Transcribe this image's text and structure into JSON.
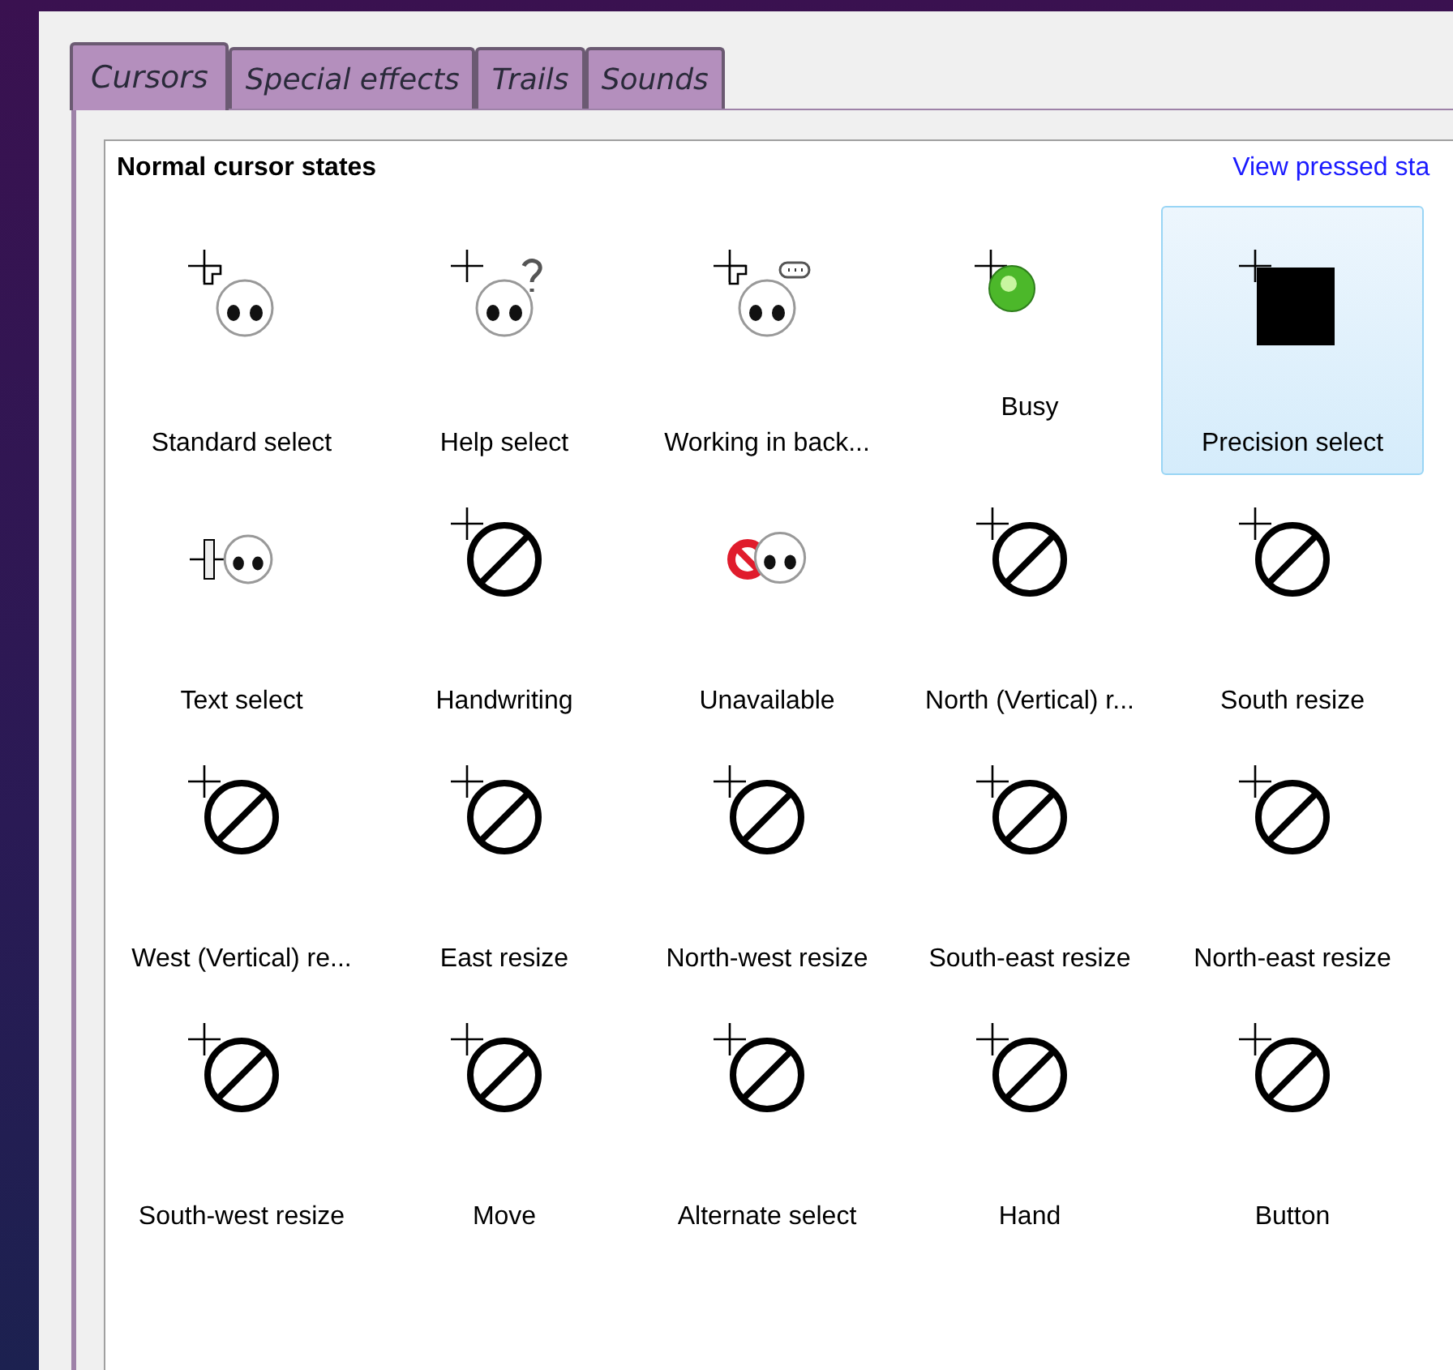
{
  "tabs": [
    {
      "label": "Cursors",
      "selected": true
    },
    {
      "label": "Special effects",
      "selected": false
    },
    {
      "label": "Trails",
      "selected": false
    },
    {
      "label": "Sounds",
      "selected": false
    }
  ],
  "section": {
    "title": "Normal cursor states",
    "link": "View pressed sta"
  },
  "cursors": [
    {
      "label": "Standard select",
      "selected": false
    },
    {
      "label": "Help select",
      "selected": false
    },
    {
      "label": "Working in back...",
      "selected": false
    },
    {
      "label": "Busy",
      "selected": false
    },
    {
      "label": "Precision select",
      "selected": true
    },
    {
      "label": "Text select",
      "selected": false
    },
    {
      "label": "Handwriting",
      "selected": false
    },
    {
      "label": "Unavailable",
      "selected": false
    },
    {
      "label": "North (Vertical) r...",
      "selected": false
    },
    {
      "label": "South resize",
      "selected": false
    },
    {
      "label": "West (Vertical) re...",
      "selected": false
    },
    {
      "label": "East resize",
      "selected": false
    },
    {
      "label": "North-west resize",
      "selected": false
    },
    {
      "label": "South-east resize",
      "selected": false
    },
    {
      "label": "North-east resize",
      "selected": false
    },
    {
      "label": "South-west resize",
      "selected": false
    },
    {
      "label": "Move",
      "selected": false
    },
    {
      "label": "Alternate select",
      "selected": false
    },
    {
      "label": "Hand",
      "selected": false
    },
    {
      "label": "Button",
      "selected": false
    }
  ]
}
